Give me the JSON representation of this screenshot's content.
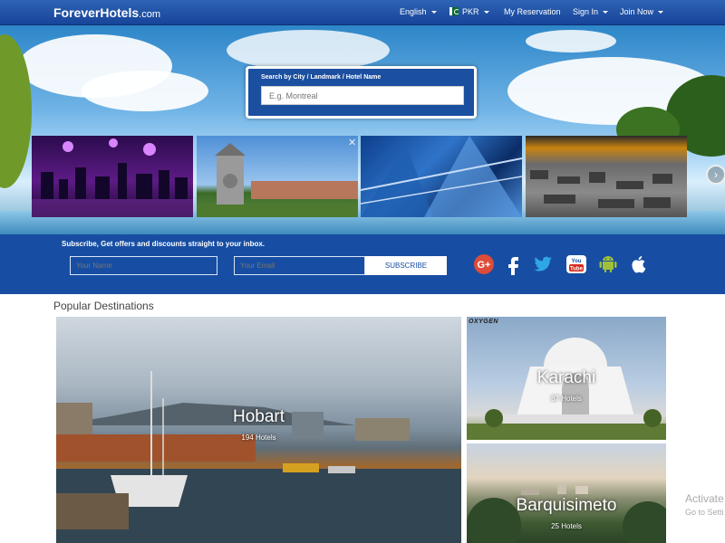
{
  "logo": {
    "part1": "Forever",
    "part2": "Hotels",
    "part3": ".com"
  },
  "nav": {
    "language": "English",
    "currency": "PKR",
    "my_reservation": "My Reservation",
    "sign_in": "Sign In",
    "join_now": "Join Now"
  },
  "search": {
    "label": "Search by City / Landmark / Hotel Name",
    "placeholder": "E.g. Montreal"
  },
  "hero": {
    "close_glyph": "✕",
    "next_glyph": "›"
  },
  "subscribe": {
    "title": "Subscribe, Get offers and discounts straight to your inbox.",
    "name_placeholder": "Your Name",
    "email_placeholder": "Your Email",
    "button": "SUBSCRIBE"
  },
  "social_icons": [
    "google-plus-icon",
    "facebook-icon",
    "twitter-icon",
    "youtube-icon",
    "android-icon",
    "apple-icon"
  ],
  "popular": {
    "title": "Popular Destinations",
    "destinations": [
      {
        "name": "Hobart",
        "count": "194 Hotels"
      },
      {
        "name": "Karachi",
        "count": "87 Hotels"
      },
      {
        "name": "Barquisimeto",
        "count": "25 Hotels"
      }
    ],
    "watermark": "OXYGEN"
  },
  "os_overlay": {
    "line1": "Activate",
    "line2": "Go to Setti"
  },
  "colors": {
    "brand_blue": "#174ea3",
    "nav_blue": "#2f63b3"
  }
}
